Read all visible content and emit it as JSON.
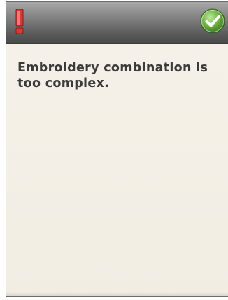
{
  "dialog": {
    "message": "Embroidery combination is too complex.",
    "icons": {
      "warning": "exclamation-icon",
      "confirm": "checkmark-icon"
    },
    "colors": {
      "warning": "#d83a3a",
      "confirm": "#5aa53a",
      "text": "#3b3b3b",
      "background": "#f3efe6"
    }
  }
}
